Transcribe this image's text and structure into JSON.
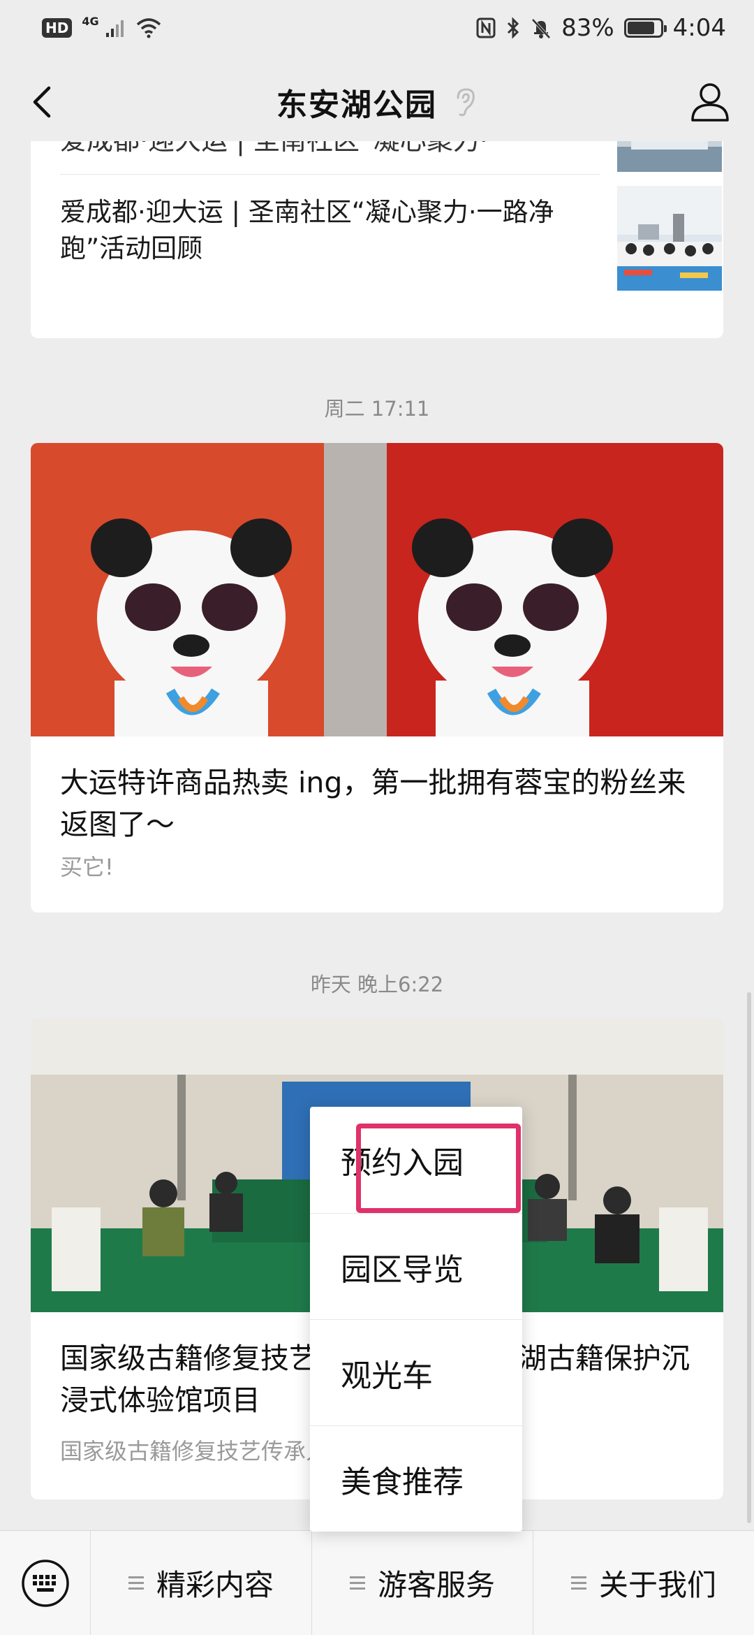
{
  "status_bar": {
    "hd": "HD",
    "network": "4G",
    "battery": "83%",
    "battery_level": 0.83,
    "time": "4:04"
  },
  "nav": {
    "title": "东安湖公园"
  },
  "feed": {
    "top_partial_text": "爱成都·迎大运 | 圣南社区“凝心聚力·一",
    "top_article": "爱成都·迎大运 | 圣南社区“凝心聚力·一路净跑”活动回顾",
    "timestamp_1": "周二 17:11",
    "article_1": {
      "title": "大运特许商品热卖 ing，第一批拥有蓉宝的粉丝来返图了～",
      "digest": "买它!"
    },
    "timestamp_2": "昨天 晚上6:22",
    "article_2": {
      "title": "国家级古籍修复技艺传承人走进东安湖古籍保护沉浸式体验馆项目",
      "digest": "国家级古籍修复技艺传承人走进东安湖公园!"
    }
  },
  "popup_menu": {
    "items": [
      "预约入园",
      "园区导览",
      "观光车",
      "美食推荐"
    ],
    "highlight_color": "#e0316a"
  },
  "bottom_menu": {
    "items": [
      "精彩内容",
      "游客服务",
      "关于我们"
    ]
  },
  "colors": {
    "background": "#ededed",
    "card": "#ffffff",
    "timestamp": "#8a8a8a"
  }
}
